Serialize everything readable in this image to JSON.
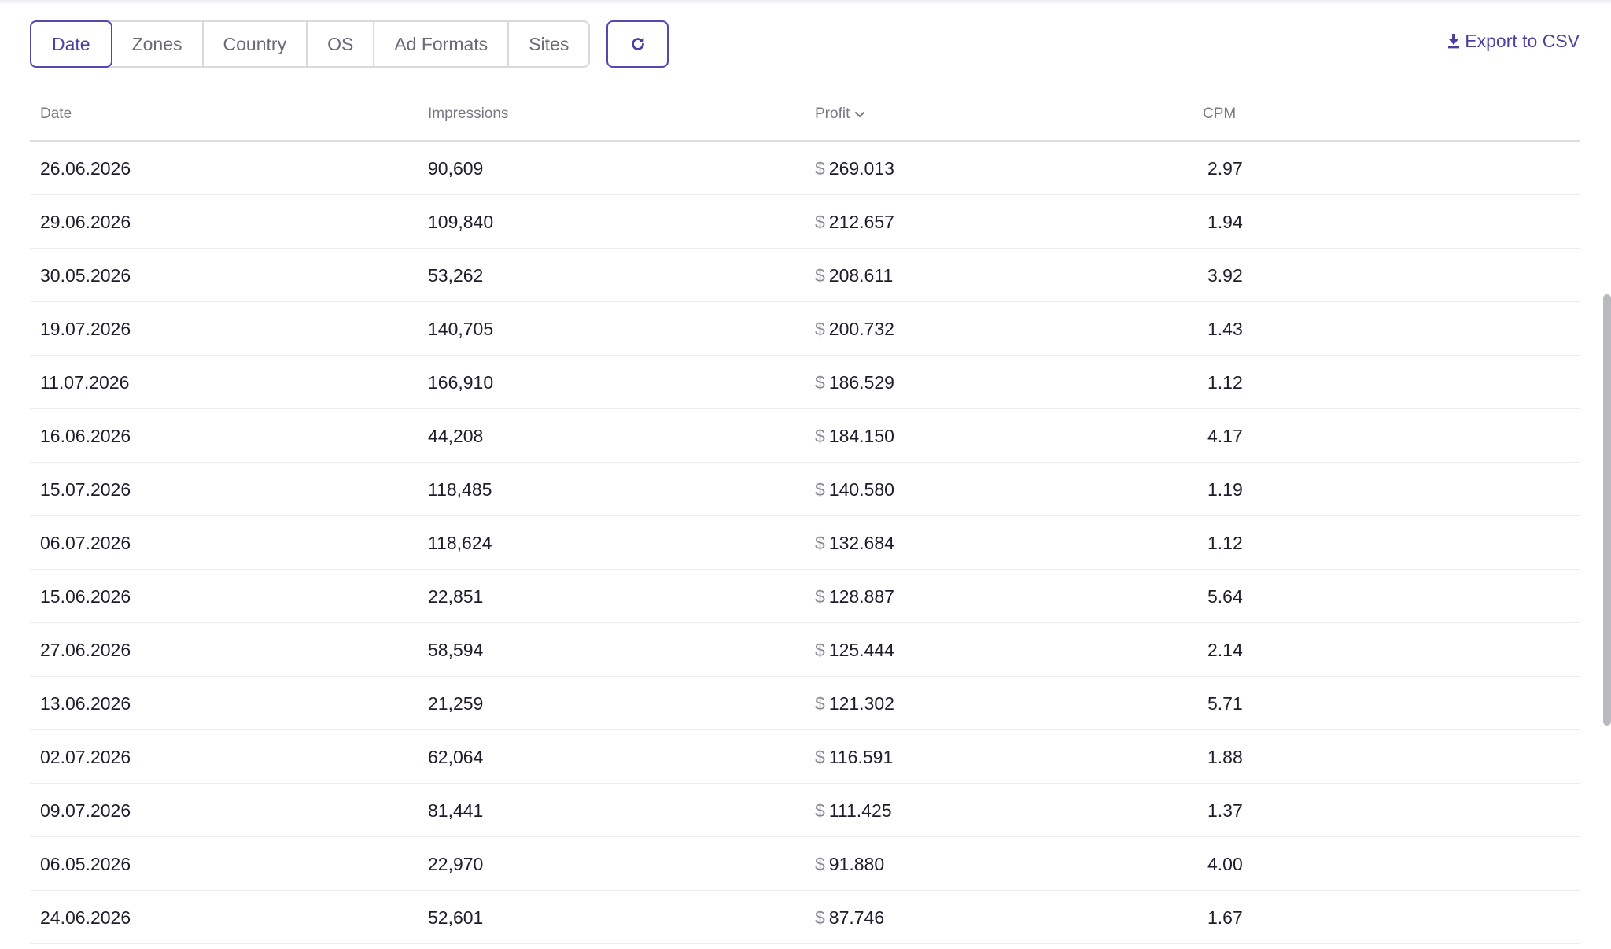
{
  "tabs": [
    {
      "label": "Date",
      "active": true
    },
    {
      "label": "Zones",
      "active": false
    },
    {
      "label": "Country",
      "active": false
    },
    {
      "label": "OS",
      "active": false
    },
    {
      "label": "Ad Formats",
      "active": false
    },
    {
      "label": "Sites",
      "active": false
    }
  ],
  "refresh": {
    "icon": "refresh-icon"
  },
  "export": {
    "label": "Export to CSV",
    "icon": "download-icon"
  },
  "table": {
    "columns": {
      "date": "Date",
      "impressions": "Impressions",
      "profit": "Profit",
      "cpm": "CPM"
    },
    "sorted_column": "profit",
    "sort_icon": "chevron-down-icon",
    "currency": "$",
    "rows": [
      {
        "date": "26.06.2026",
        "impressions": "90,609",
        "profit": "269.013",
        "cpm": "2.97"
      },
      {
        "date": "29.06.2026",
        "impressions": "109,840",
        "profit": "212.657",
        "cpm": "1.94"
      },
      {
        "date": "30.05.2026",
        "impressions": "53,262",
        "profit": "208.611",
        "cpm": "3.92"
      },
      {
        "date": "19.07.2026",
        "impressions": "140,705",
        "profit": "200.732",
        "cpm": "1.43"
      },
      {
        "date": "11.07.2026",
        "impressions": "166,910",
        "profit": "186.529",
        "cpm": "1.12"
      },
      {
        "date": "16.06.2026",
        "impressions": "44,208",
        "profit": "184.150",
        "cpm": "4.17"
      },
      {
        "date": "15.07.2026",
        "impressions": "118,485",
        "profit": "140.580",
        "cpm": "1.19"
      },
      {
        "date": "06.07.2026",
        "impressions": "118,624",
        "profit": "132.684",
        "cpm": "1.12"
      },
      {
        "date": "15.06.2026",
        "impressions": "22,851",
        "profit": "128.887",
        "cpm": "5.64"
      },
      {
        "date": "27.06.2026",
        "impressions": "58,594",
        "profit": "125.444",
        "cpm": "2.14"
      },
      {
        "date": "13.06.2026",
        "impressions": "21,259",
        "profit": "121.302",
        "cpm": "5.71"
      },
      {
        "date": "02.07.2026",
        "impressions": "62,064",
        "profit": "116.591",
        "cpm": "1.88"
      },
      {
        "date": "09.07.2026",
        "impressions": "81,441",
        "profit": "111.425",
        "cpm": "1.37"
      },
      {
        "date": "06.05.2026",
        "impressions": "22,970",
        "profit": "91.880",
        "cpm": "4.00"
      },
      {
        "date": "24.06.2026",
        "impressions": "52,601",
        "profit": "87.746",
        "cpm": "1.67"
      }
    ]
  },
  "colors": {
    "accent": "#4b3fa0",
    "accent_border": "#5546b0",
    "border": "#d9d9e0",
    "muted_text": "#7a7a86",
    "text": "#1d1d2b"
  }
}
